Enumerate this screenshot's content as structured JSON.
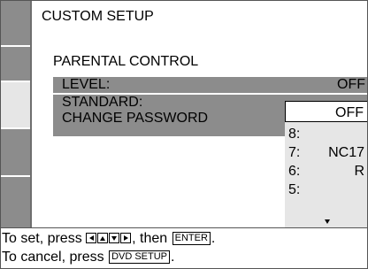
{
  "header": {
    "title": "CUSTOM SETUP"
  },
  "section": {
    "title": "PARENTAL CONTROL"
  },
  "settings": [
    {
      "label": "LEVEL:",
      "value": "OFF"
    },
    {
      "label": "STANDARD:",
      "value": ""
    },
    {
      "label": "CHANGE PASSWORD",
      "value": ""
    }
  ],
  "level_dropdown": {
    "selected": "OFF",
    "options": [
      {
        "num": "8:",
        "rating": ""
      },
      {
        "num": "7:",
        "rating": "NC17"
      },
      {
        "num": "6:",
        "rating": "R"
      },
      {
        "num": "5:",
        "rating": ""
      }
    ]
  },
  "help": {
    "line1_prefix": "To set, press",
    "line1_mid": ", then",
    "enter_key": "ENTER",
    "line1_suffix": ".",
    "line2_prefix": "To cancel, press",
    "setup_key": "DVD SETUP",
    "line2_suffix": "."
  },
  "colors": {
    "highlight_gray": "#8c8c8c",
    "light_gray": "#e6e6e6",
    "dark_gray": "#6e6e6e"
  }
}
